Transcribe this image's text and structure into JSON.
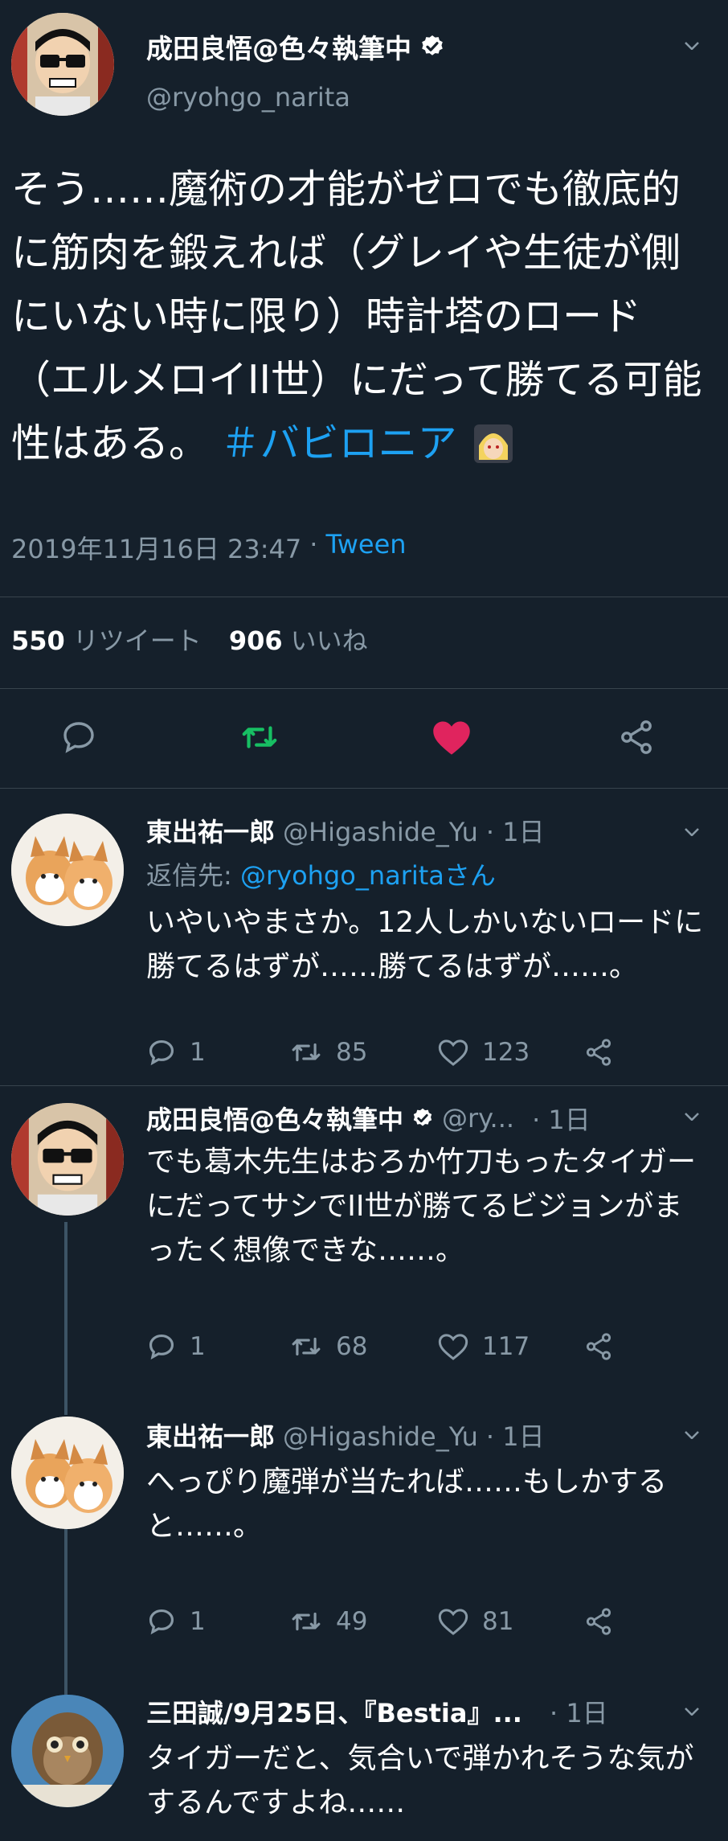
{
  "main_tweet": {
    "display_name": "成田良悟@色々執筆中",
    "handle": "@ryohgo_narita",
    "text": "そう……魔術の才能がゼロでも徹底的に筋肉を鍛えれば（グレイや生徒が側にいない時に限り）時計塔のロード（エルメロイII世）にだって勝てる可能性はある。",
    "hashtag": "＃バビロニア",
    "timestamp": "2019年11月16日 23:47",
    "separator": "·",
    "source": "Tween",
    "retweet_count": "550",
    "retweet_label": "リツイート",
    "like_count": "906",
    "like_label": "いいね"
  },
  "replies": [
    {
      "display_name": "東出祐一郎",
      "handle": "@Higashide_Yu",
      "time": "· 1日",
      "reply_to_prefix": "返信先: ",
      "reply_to_handle": "@ryohgo_narita",
      "reply_to_suffix": "さん",
      "text": "いやいやまさか。12人しかいないロードに勝てるはずが……勝てるはずが……。",
      "replies": "1",
      "retweets": "85",
      "likes": "123"
    },
    {
      "display_name": "成田良悟@色々執筆中",
      "handle": "@ry...",
      "time": "· 1日",
      "text": "でも葛木先生はおろか竹刀もったタイガーにだってサシでII世が勝てるビジョンがまったく想像できな……。",
      "replies": "1",
      "retweets": "68",
      "likes": "117"
    },
    {
      "display_name": "東出祐一郎",
      "handle": "@Higashide_Yu",
      "time": "· 1日",
      "text": "へっぴり魔弾が当たれば……もしかすると……。",
      "replies": "1",
      "retweets": "49",
      "likes": "81"
    },
    {
      "display_name": "三田誠/9月25日、『Bestia』...",
      "handle": "",
      "time": "· 1日",
      "text": "タイガーだと、気合いで弾かれそうな気がするんですよね……"
    }
  ],
  "icons": {
    "verified": "verified-badge-icon",
    "reply": "reply-icon",
    "retweet": "retweet-icon",
    "like": "heart-icon",
    "share": "share-icon",
    "chevron": "chevron-down-icon"
  },
  "colors": {
    "background": "#15202b",
    "accent": "#1da1f2",
    "retweet_green": "#17bf63",
    "like_red": "#e0245e",
    "muted": "#8899a6"
  }
}
